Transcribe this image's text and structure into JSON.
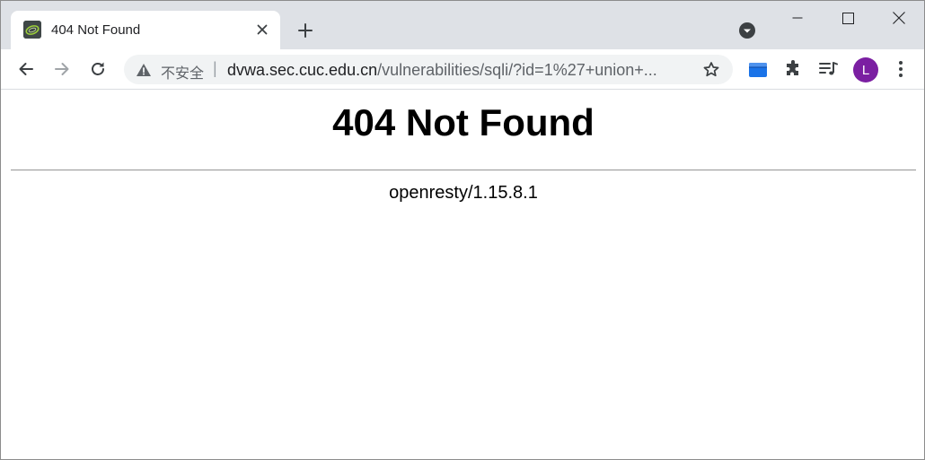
{
  "browser": {
    "tab": {
      "title": "404 Not Found"
    },
    "address_bar": {
      "security_label": "不安全",
      "separator": "|",
      "url_host": "dvwa.sec.cuc.edu.cn",
      "url_path": "/vulnerabilities/sqli/?id=1%27+union+..."
    },
    "profile": {
      "initial": "L",
      "color": "#7b1fa2"
    },
    "icons": {
      "tab_favicon": "site-favicon-icon",
      "tab_close": "close-icon",
      "new_tab": "plus-icon",
      "tab_search": "chevron-down-icon",
      "minimize": "minimize-icon",
      "maximize": "maximize-icon",
      "close_window": "close-icon",
      "back": "arrow-left-icon",
      "forward": "arrow-right-icon",
      "reload": "reload-icon",
      "not_secure": "warning-icon",
      "bookmark": "star-icon",
      "extension": "blue-book-icon",
      "extensions_menu": "puzzle-icon",
      "media_control": "playlist-music-icon",
      "menu": "kebab-menu-icon"
    }
  },
  "page": {
    "heading": "404 Not Found",
    "server": "openresty/1.15.8.1"
  }
}
